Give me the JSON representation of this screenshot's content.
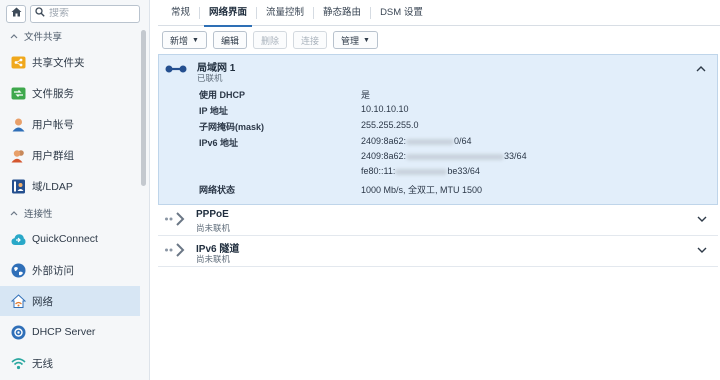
{
  "search": {
    "placeholder": "搜索"
  },
  "sidebar": {
    "sections": [
      {
        "label": "文件共享"
      },
      {
        "label": "连接性"
      }
    ],
    "items": [
      {
        "label": "共享文件夹",
        "icon": "shared-folder-icon"
      },
      {
        "label": "文件服务",
        "icon": "file-services-icon"
      },
      {
        "label": "用户帐号",
        "icon": "user-icon"
      },
      {
        "label": "用户群组",
        "icon": "group-icon"
      },
      {
        "label": "域/LDAP",
        "icon": "domain-ldap-icon"
      },
      {
        "label": "QuickConnect",
        "icon": "quickconnect-icon"
      },
      {
        "label": "外部访问",
        "icon": "external-access-icon"
      },
      {
        "label": "网络",
        "icon": "network-icon",
        "active": true
      },
      {
        "label": "DHCP Server",
        "icon": "dhcp-icon"
      },
      {
        "label": "无线",
        "icon": "wireless-icon"
      }
    ]
  },
  "tabs": [
    {
      "label": "常规"
    },
    {
      "label": "网络界面",
      "active": true
    },
    {
      "label": "流量控制"
    },
    {
      "label": "静态路由"
    },
    {
      "label": "DSM 设置"
    }
  ],
  "toolbar": {
    "create": "新增",
    "edit": "编辑",
    "delete": "删除",
    "connect": "连接",
    "manage": "管理"
  },
  "interfaces": [
    {
      "name": "局域网 1",
      "status": "已联机",
      "expanded": true,
      "details": {
        "dhcp_label": "使用 DHCP",
        "dhcp_value": "是",
        "ip_label": "IP 地址",
        "ip_value": "10.10.10.10",
        "mask_label": "子网掩码(mask)",
        "mask_value": "255.255.255.0",
        "ipv6_label": "IPv6 地址",
        "ipv6_line1_prefix": "2409:8a62:",
        "ipv6_line1_suffix": "0/64",
        "ipv6_line2_prefix": "2409:8a62:",
        "ipv6_line2_suffix": "33/64",
        "ipv6_line3_prefix": "fe80::11:",
        "ipv6_line3_suffix": "be33/64",
        "netstatus_label": "网络状态",
        "netstatus_value": "1000 Mb/s, 全双工, MTU 1500"
      }
    },
    {
      "name": "PPPoE",
      "status": "尚未联机"
    },
    {
      "name": "IPv6 隧道",
      "status": "尚未联机"
    }
  ],
  "colors": {
    "accent": "#2e6fb5",
    "selected_bg": "#e2eefa",
    "sidebar_active_bg": "#d7e6f4"
  }
}
